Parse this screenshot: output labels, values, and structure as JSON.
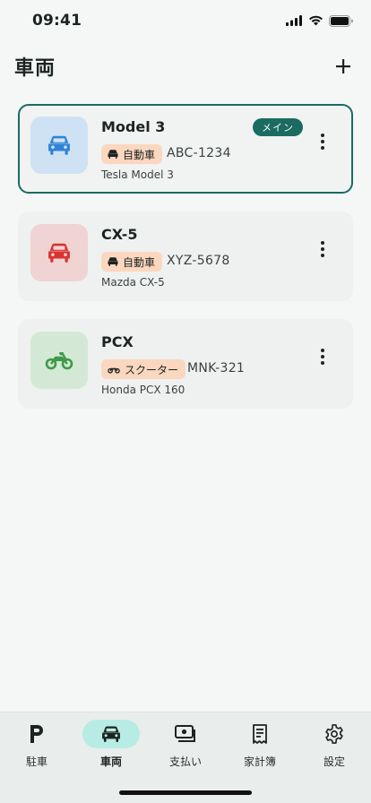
{
  "status_bar": {
    "time": "09:41"
  },
  "header": {
    "title": "車両",
    "add_label": "+"
  },
  "vehicles": [
    {
      "name": "Model 3",
      "type_label": "自動車",
      "type_icon": "car-icon",
      "plate": "ABC-1234",
      "model": "Tesla Model 3",
      "badge": "メイン",
      "icon": "car-icon",
      "icon_color": "#2f83d8",
      "thumb_bg": "#cfe2f3"
    },
    {
      "name": "CX-5",
      "type_label": "自動車",
      "type_icon": "car-icon",
      "plate": "XYZ-5678",
      "model": "Mazda CX-5",
      "badge": "",
      "icon": "car-icon",
      "icon_color": "#d9332f",
      "thumb_bg": "#f0d3d3"
    },
    {
      "name": "PCX",
      "type_label": "スクーター",
      "type_icon": "motorcycle-icon",
      "plate": "MNK-321",
      "model": "Honda PCX 160",
      "badge": "",
      "icon": "motorcycle-icon",
      "icon_color": "#3e9a4a",
      "thumb_bg": "#d3e9d5"
    }
  ],
  "nav": {
    "items": [
      {
        "label": "駐車",
        "icon": "parking-icon"
      },
      {
        "label": "車両",
        "icon": "car-icon"
      },
      {
        "label": "支払い",
        "icon": "payment-icon"
      },
      {
        "label": "家計簿",
        "icon": "receipt-icon"
      },
      {
        "label": "設定",
        "icon": "gear-icon"
      }
    ],
    "active_index": 1
  },
  "colors": {
    "accent": "#1b6b61",
    "active_nav_bg": "#b6ece3",
    "chip_bg": "#fbd7c0"
  }
}
